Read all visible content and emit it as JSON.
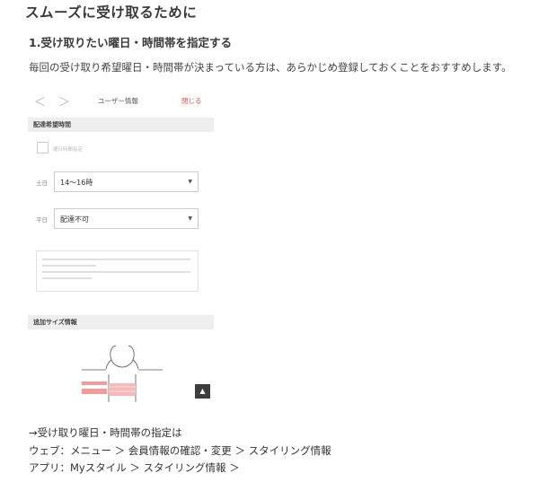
{
  "article": {
    "title": "スムーズに受け取るために",
    "subtitle": "1.受け取りたい曜日・時間帯を指定する",
    "intro": "毎回の受け取り希望曜日・時間帯が決まっている方は、あらかじめ登録しておくことをおすすめします。"
  },
  "phone": {
    "nav": {
      "back_glyph": "＜",
      "forward_glyph": "＞",
      "title": "ユーザー情報",
      "close": "閉じる"
    },
    "delivery_section": {
      "title": "配達希望時間",
      "checkbox_label": "曜日時間指定"
    },
    "rows": [
      {
        "label": "土日",
        "value": "14〜16時"
      },
      {
        "label": "平日",
        "value": "配達不可"
      }
    ],
    "size_section": {
      "title": "追加サイズ情報"
    },
    "scroll_top_glyph": "▲",
    "caret_glyph": "▼"
  },
  "footer": {
    "line1": "→受け取り曜日・時間帯の指定は",
    "line2": "ウェブ：メニュー ＞ 会員情報の確認・変更 ＞ スタイリング情報",
    "line3": "アプリ：Myスタイル ＞ スタイリング情報 ＞"
  },
  "colors": {
    "accent": "#e05050",
    "section_bg": "#eeeeee",
    "figure_pink": "#f19b9b"
  }
}
